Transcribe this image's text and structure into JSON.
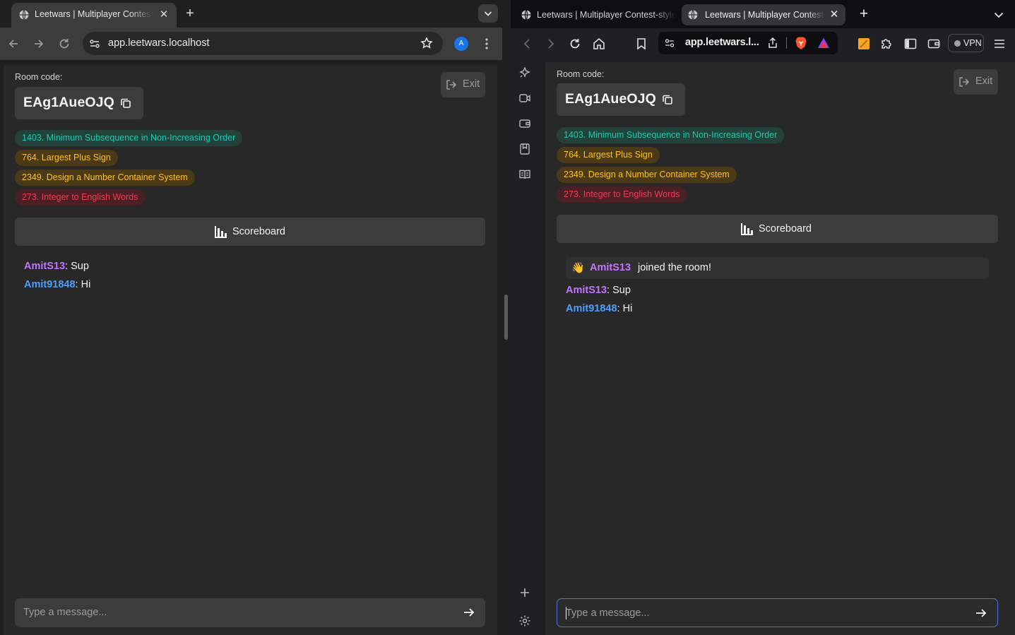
{
  "left_browser": {
    "tab_title": "Leetwars | Multiplayer Contest-style LeetCode",
    "url": "app.leetwars.localhost",
    "avatar_letter": "A"
  },
  "right_browser": {
    "tab1_title": "Leetwars | Multiplayer Contest-style LeetCode",
    "tab2_title": "Leetwars | Multiplayer Contest-style LeetCode",
    "url": "app.leetwars.l...",
    "vpn_label": "VPN"
  },
  "room": {
    "label": "Room code:",
    "code": "EAg1AueOJQ",
    "exit_label": "Exit"
  },
  "problems": [
    {
      "title": "1403. Minimum Subsequence in Non-Increasing Order",
      "difficulty": "easy"
    },
    {
      "title": "764. Largest Plus Sign",
      "difficulty": "medium"
    },
    {
      "title": "2349. Design a Number Container System",
      "difficulty": "medium"
    },
    {
      "title": "273. Integer to English Words",
      "difficulty": "hard"
    }
  ],
  "scoreboard_label": "Scoreboard",
  "join_notice": {
    "emoji": "👋",
    "user": "AmitS13",
    "text": "joined the room!"
  },
  "messages": [
    {
      "user": "AmitS13",
      "text": ": Sup"
    },
    {
      "user": "Amit91848",
      "text": ": Hi"
    }
  ],
  "chat_input": {
    "placeholder": "Type a message..."
  },
  "colors": {
    "easy": "#1ccbb0",
    "medium": "#ffc01e",
    "hard": "#ef3b5a",
    "user_purple": "#c474ff",
    "user_blue": "#4e9eff"
  }
}
